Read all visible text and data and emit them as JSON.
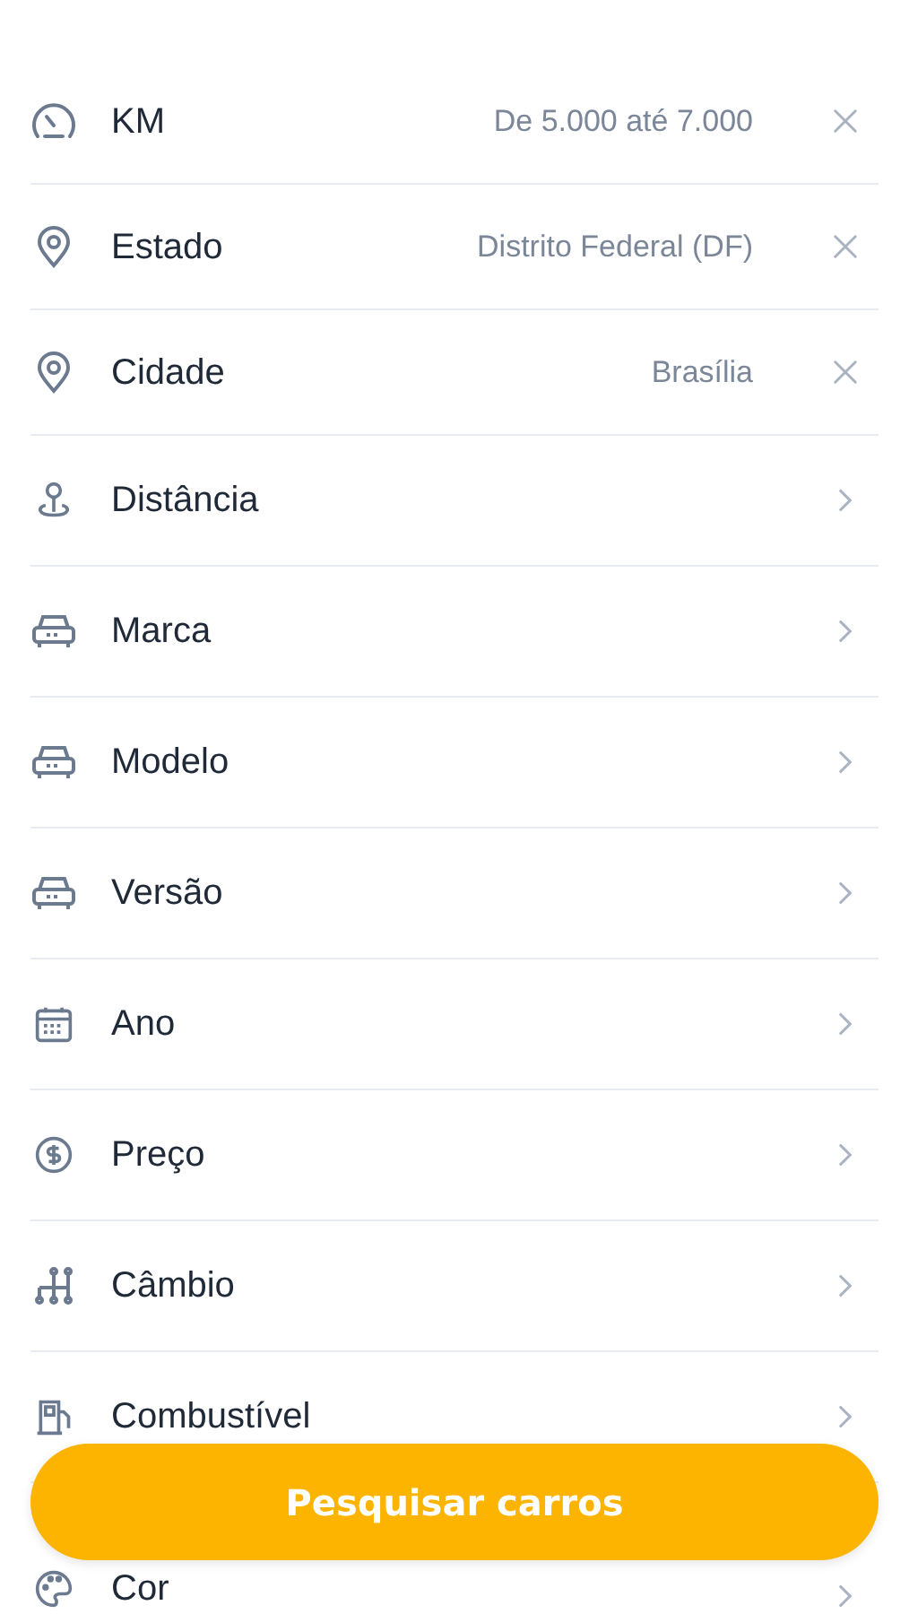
{
  "filters": [
    {
      "kind": "filled",
      "label": "KM",
      "value": "De 5.000 até 7.000"
    },
    {
      "kind": "filled",
      "label": "Estado",
      "value": "Distrito Federal (DF)"
    },
    {
      "kind": "filled",
      "label": "Cidade",
      "value": "Brasília"
    },
    {
      "kind": "nav",
      "label": "Distância"
    },
    {
      "kind": "nav",
      "label": "Marca"
    },
    {
      "kind": "nav",
      "label": "Modelo"
    },
    {
      "kind": "nav",
      "label": "Versão"
    },
    {
      "kind": "nav",
      "label": "Ano"
    },
    {
      "kind": "nav",
      "label": "Preço"
    },
    {
      "kind": "nav",
      "label": "Câmbio"
    },
    {
      "kind": "nav",
      "label": "Combustível"
    },
    {
      "kind": "nav",
      "label": "Cor"
    }
  ],
  "search_button": {
    "label": "Pesquisar carros"
  }
}
